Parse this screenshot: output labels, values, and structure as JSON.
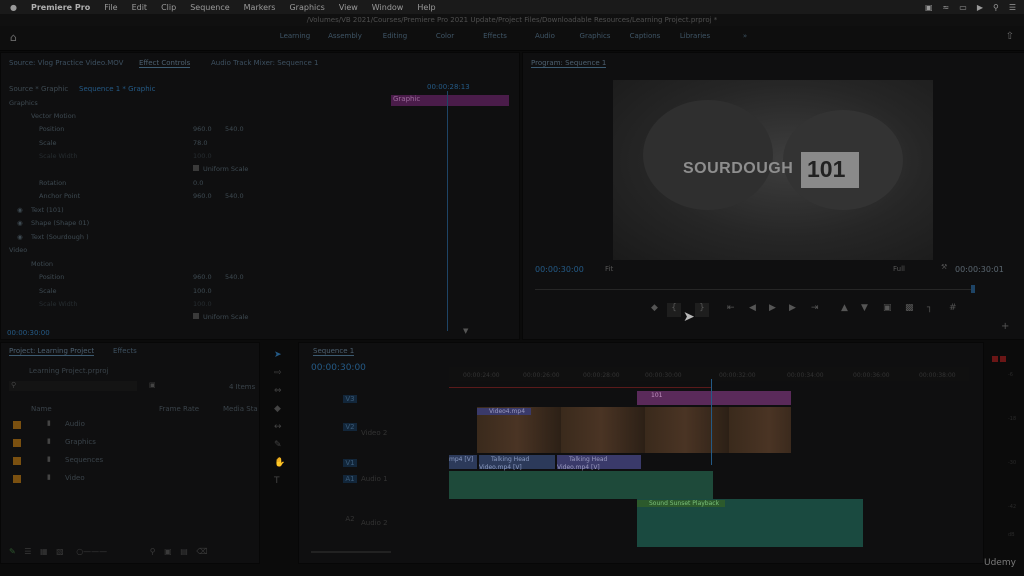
{
  "menubar": {
    "apple": "",
    "app_name": "Premiere Pro",
    "items": [
      "File",
      "Edit",
      "Clip",
      "Sequence",
      "Markers",
      "Graphics",
      "View",
      "Window",
      "Help"
    ]
  },
  "title": "/Volumes/VB 2021/Courses/Premiere Pro 2021 Update/Project Files/Downloadable Resources/Learning Project.prproj *",
  "workspaces": [
    "Learning",
    "Assembly",
    "Editing",
    "Color",
    "Effects",
    "Audio",
    "Graphics",
    "Captions",
    "Libraries"
  ],
  "source_panel": {
    "tabs": [
      "Source: Vlog Practice Video.MOV",
      "Effect Controls",
      "Audio Track Mixer: Sequence 1"
    ],
    "header_left": "Source * Graphic",
    "header_right": "Sequence 1 * Graphic",
    "mini_timecode": "00:00:28:13",
    "clip_label": "Graphic",
    "section_graphics": "Graphics",
    "vector_motion": "Vector Motion",
    "props": [
      {
        "name": "Position",
        "v1": "960.0",
        "v2": "540.0"
      },
      {
        "name": "Scale",
        "v1": "78.0",
        "v2": ""
      },
      {
        "name": "Scale Width",
        "v1": "100.0",
        "v2": ""
      },
      {
        "name": "Uniform Scale",
        "v1": "",
        "v2": ""
      },
      {
        "name": "Rotation",
        "v1": "0.0",
        "v2": ""
      },
      {
        "name": "Anchor Point",
        "v1": "960.0",
        "v2": "540.0"
      }
    ],
    "layers": [
      "Text (101)",
      "Shape (Shape 01)",
      "Text (Sourdough )"
    ],
    "section_video": "Video",
    "motion": "Motion",
    "props2": [
      {
        "name": "Position",
        "v1": "960.0",
        "v2": "540.0"
      },
      {
        "name": "Scale",
        "v1": "100.0",
        "v2": ""
      },
      {
        "name": "Scale Width",
        "v1": "100.0",
        "v2": ""
      },
      {
        "name": "Uniform Scale",
        "v1": "",
        "v2": ""
      }
    ],
    "footer_timecode": "00:00:30:00"
  },
  "program_panel": {
    "title": "Program: Sequence 1",
    "overlay_text": "SOURDOUGH",
    "overlay_number": "101",
    "timecode": "00:00:30:00",
    "fit": "Fit",
    "quality": "Full",
    "duration": "00:00:30:01"
  },
  "project_panel": {
    "tabs": [
      "Project: Learning Project",
      "Effects"
    ],
    "file": "Learning Project.prproj",
    "item_count": "4 Items",
    "columns": [
      "Name",
      "Frame Rate",
      "Media Sta"
    ],
    "items": [
      "Audio",
      "Graphics",
      "Sequences",
      "Video"
    ],
    "colors": [
      "#8a5a12",
      "#8a5a12",
      "#8a5a12",
      "#8a5a12"
    ]
  },
  "timeline": {
    "tab": "Sequence 1",
    "timecode": "00:00:30:00",
    "ruler": [
      "00:00:24:00",
      "00:00:26:00",
      "00:00:28:00",
      "00:00:30:00",
      "00:00:32:00",
      "00:00:34:00",
      "00:00:36:00",
      "00:00:38:00"
    ],
    "tracks": [
      "V3",
      "V2",
      "V1",
      "A1",
      "A2"
    ],
    "track_names": [
      "",
      "Video 2",
      "",
      "Audio 1",
      "Audio 2"
    ],
    "clips": {
      "graphic": "101",
      "video4": "Video4.mp4",
      "v1a": "mp4 [V]",
      "v1b": "Talking Head Video.mp4 [V]",
      "v1c": "Talking Head Video.mp4 [V]",
      "audio2": "Sound Sunset Playback"
    },
    "meter_labels": [
      "0",
      "-6",
      "-12",
      "-18",
      "-24",
      "-30",
      "-36",
      "-42",
      "-48",
      "dB"
    ]
  },
  "watermark": "Udemy"
}
